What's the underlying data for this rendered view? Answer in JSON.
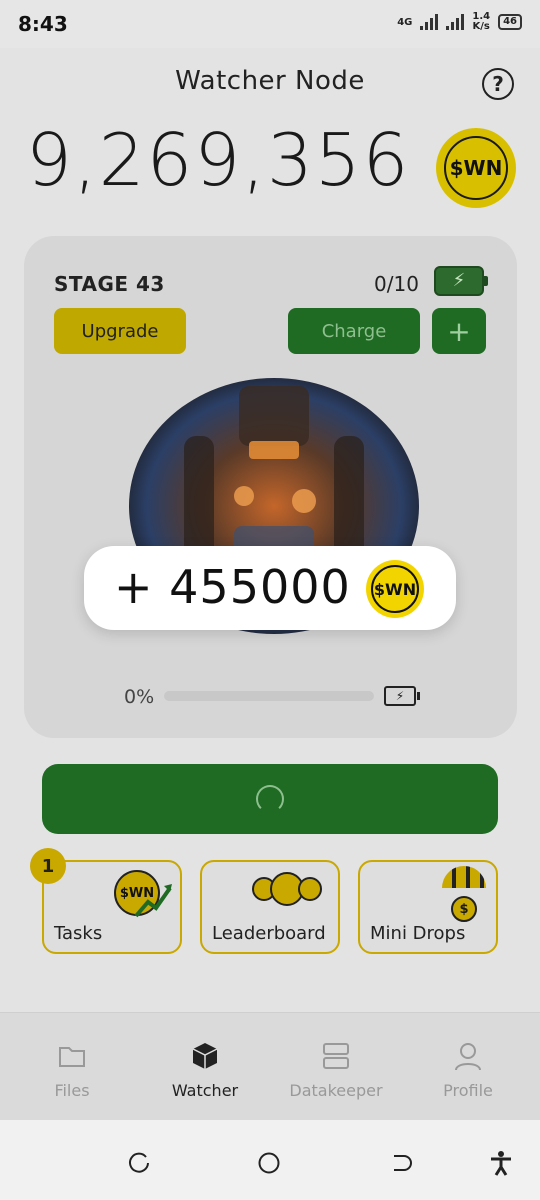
{
  "status_bar": {
    "time": "8:43",
    "network": "4G",
    "speed_value": "1.4",
    "speed_unit": "K/s",
    "battery": "46"
  },
  "header": {
    "title": "Watcher Node",
    "help_icon": "question-circle-icon"
  },
  "balance": {
    "amount": "9,269,356",
    "currency_label": "$WN"
  },
  "stage_card": {
    "stage": "STAGE 43",
    "charges": "0/10",
    "upgrade_label": "Upgrade",
    "charge_label": "Charge",
    "plus_label": "+",
    "progress_label": "0%",
    "progress_value": 0
  },
  "popup": {
    "text": "+ 455000",
    "currency_label": "$WN"
  },
  "main_button": {
    "state": "loading"
  },
  "tiles": [
    {
      "label": "Tasks",
      "badge": "1",
      "icon": "coin-chart-icon",
      "coin_text": "$WN"
    },
    {
      "label": "Leaderboard",
      "icon": "people-icon"
    },
    {
      "label": "Mini Drops",
      "icon": "parachute-coin-icon",
      "coin_text": "$"
    }
  ],
  "bottom_nav": [
    {
      "label": "Files",
      "icon": "folder-icon",
      "active": false
    },
    {
      "label": "Watcher",
      "icon": "cube-icon",
      "active": true
    },
    {
      "label": "Datakeeper",
      "icon": "server-icon",
      "active": false
    },
    {
      "label": "Profile",
      "icon": "user-icon",
      "active": false
    }
  ],
  "colors": {
    "accent_green": "#1f6b23",
    "accent_gold": "#c9a800",
    "coin_yellow": "#f2d500"
  }
}
